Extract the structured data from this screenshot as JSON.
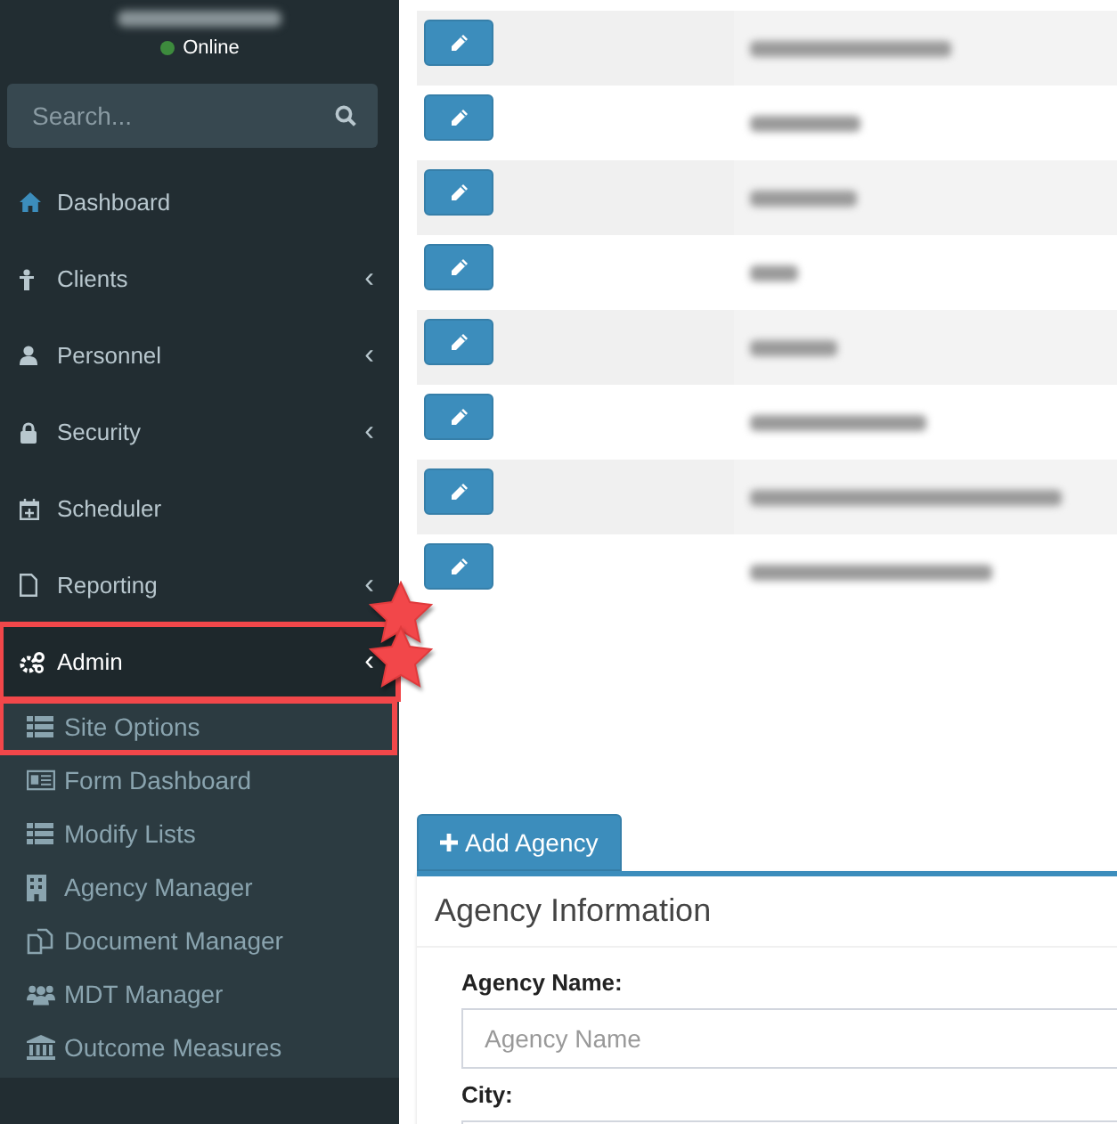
{
  "user": {
    "status": "Online",
    "online": true
  },
  "search": {
    "placeholder": "Search..."
  },
  "menu": [
    {
      "label": "Dashboard",
      "active": false,
      "annotated": false
    },
    {
      "label": "Clients",
      "chevron": "‹",
      "active": false,
      "annotated": false
    },
    {
      "label": "Personnel",
      "chevron": "‹",
      "active": false,
      "annotated": false
    },
    {
      "label": "Security",
      "chevron": "‹",
      "active": false,
      "annotated": false
    },
    {
      "label": "Scheduler",
      "active": false,
      "annotated": false
    },
    {
      "label": "Reporting",
      "chevron": "‹",
      "active": false,
      "annotated": false
    },
    {
      "label": "Admin",
      "chevron": "‹",
      "active": true,
      "annotated": true,
      "children": [
        {
          "label": "Site Options",
          "annotated": true
        },
        {
          "label": "Form Dashboard",
          "annotated": false
        },
        {
          "label": "Modify Lists",
          "annotated": false
        },
        {
          "label": "Agency Manager",
          "annotated": false
        },
        {
          "label": "Document Manager",
          "annotated": false
        },
        {
          "label": "MDT Manager",
          "annotated": false
        },
        {
          "label": "Outcome Measures",
          "annotated": false
        }
      ]
    }
  ],
  "table": {
    "rows": [
      {
        "kind": "redacted"
      },
      {
        "kind": "redacted"
      },
      {
        "kind": "redacted"
      },
      {
        "kind": "redacted"
      },
      {
        "kind": "redacted"
      },
      {
        "kind": "redacted"
      },
      {
        "kind": "redacted"
      },
      {
        "kind": "redacted"
      }
    ]
  },
  "add_button": {
    "label": "Add Agency"
  },
  "panel": {
    "title": "Agency Information",
    "fields": [
      {
        "label": "Agency Name:",
        "placeholder": "Agency Name"
      },
      {
        "label": "City:"
      }
    ]
  }
}
